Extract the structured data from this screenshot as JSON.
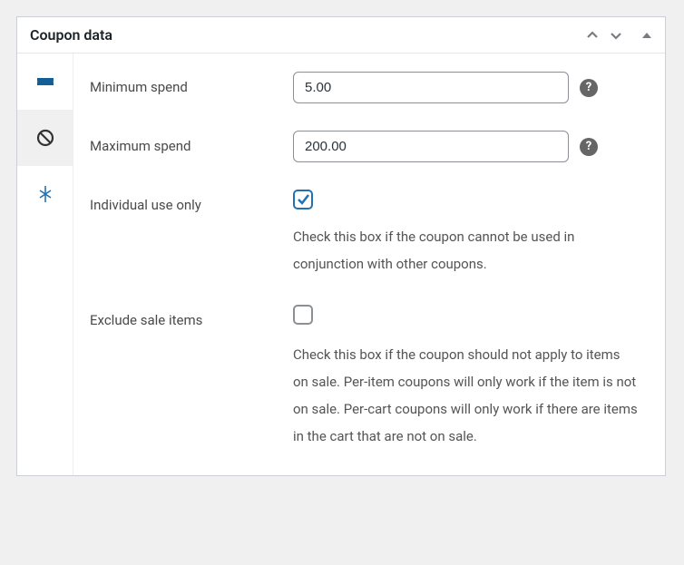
{
  "panel": {
    "title": "Coupon data"
  },
  "tabs": [
    {
      "name": "general",
      "active": false
    },
    {
      "name": "usage-restriction",
      "active": true
    },
    {
      "name": "usage-limits",
      "active": false
    }
  ],
  "fields": {
    "minimum_spend": {
      "label": "Minimum spend",
      "value": "5.00"
    },
    "maximum_spend": {
      "label": "Maximum spend",
      "value": "200.00"
    },
    "individual_use": {
      "label": "Individual use only",
      "checked": true,
      "description": "Check this box if the coupon cannot be used in conjunction with other coupons."
    },
    "exclude_sale": {
      "label": "Exclude sale items",
      "checked": false,
      "description": "Check this box if the coupon should not apply to items on sale. Per-item coupons will only work if the item is not on sale. Per-cart coupons will only work if there are items in the cart that are not on sale."
    }
  }
}
